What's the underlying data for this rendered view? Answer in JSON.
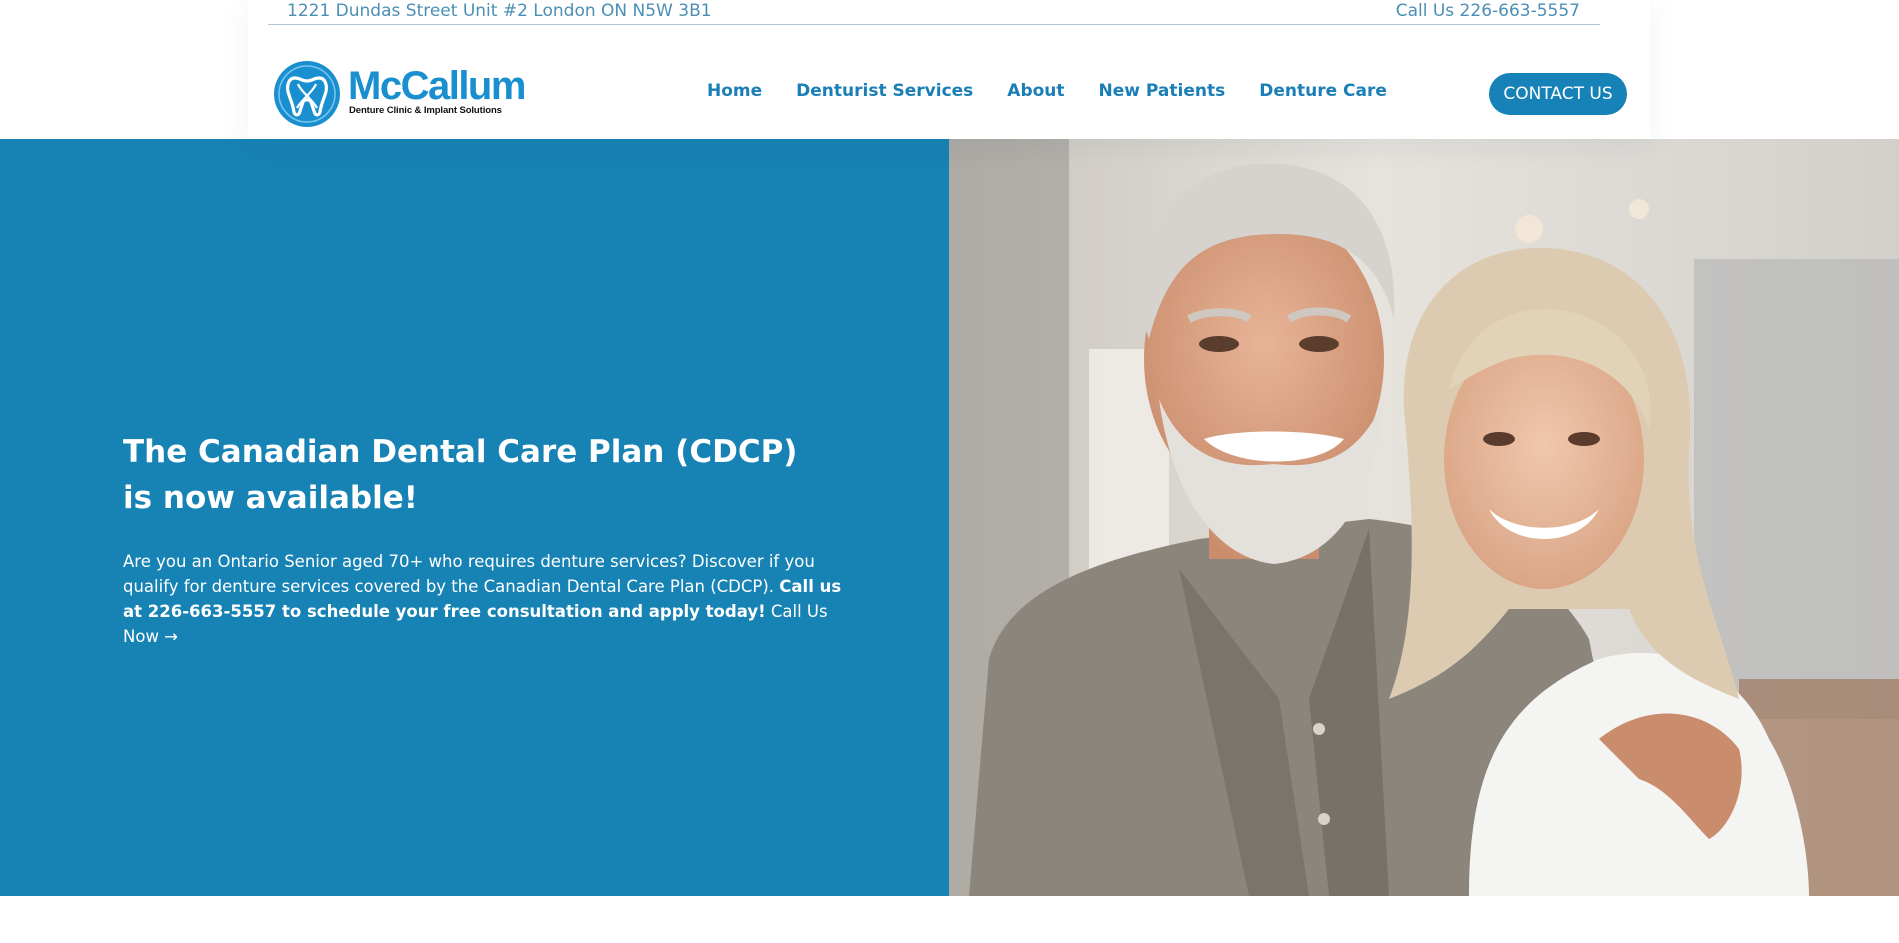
{
  "topbar": {
    "address": "1221 Dundas Street Unit #2 London ON N5W 3B1",
    "phone": "Call Us 226-663-5557"
  },
  "logo": {
    "name": "McCallum",
    "tagline": "Denture Clinic & Implant Solutions",
    "icon": "tooth-icon",
    "brand_color": "#1a8fd0"
  },
  "nav": {
    "items": [
      {
        "label": "Home"
      },
      {
        "label": "Denturist Services"
      },
      {
        "label": "About"
      },
      {
        "label": "New Patients"
      },
      {
        "label": "Denture Care"
      }
    ]
  },
  "header": {
    "contact_label": "CONTACT US"
  },
  "hero": {
    "title": "The Canadian Dental Care Plan (CDCP) is now available!",
    "text": "Are you an Ontario Senior aged 70+ who requires denture services? Discover if you qualify for denture services covered by the Canadian Dental Care Plan (CDCP).",
    "bold_text": "Call us at 226-663-5557 to schedule your free consultation and apply today!",
    "link_label": "Call Us Now →",
    "background_color": "#1782b4",
    "image_subject": "smiling senior couple photo"
  }
}
